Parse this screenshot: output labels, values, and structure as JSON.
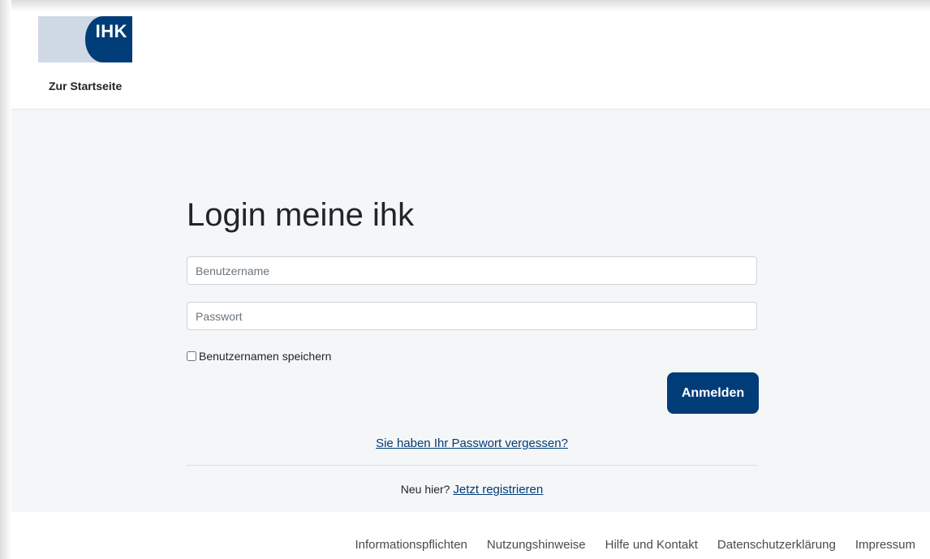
{
  "header": {
    "logo_text": "IHK",
    "home_link": "Zur Startseite"
  },
  "login": {
    "title": "Login meine ihk",
    "username_placeholder": "Benutzername",
    "password_placeholder": "Passwort",
    "remember_label": "Benutzernamen speichern",
    "submit_label": "Anmelden",
    "forgot_link": "Sie haben Ihr Passwort vergessen?",
    "new_here": "Neu hier?",
    "register_link": "Jetzt registrieren"
  },
  "footer": {
    "links": [
      "Informationspflichten",
      "Nutzungshinweise",
      "Hilfe und Kontakt",
      "Datenschutzerklärung",
      "Impressum"
    ]
  },
  "colors": {
    "brand_blue": "#003c78",
    "logo_light": "#cfd9e5",
    "page_background": "#f5f6f7"
  }
}
